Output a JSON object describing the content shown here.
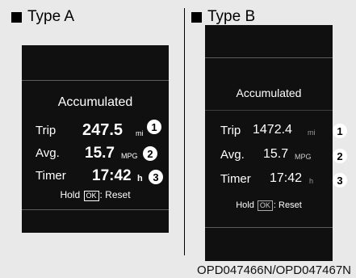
{
  "type_a": {
    "heading": "Type A",
    "accumulated": "Accumulated",
    "trip": {
      "label": "Trip",
      "value": "247.5",
      "unit": "mi",
      "callout": "1"
    },
    "avg": {
      "label": "Avg.",
      "value": "15.7",
      "unit": "MPG",
      "callout": "2"
    },
    "timer": {
      "label": "Timer",
      "value": "17:42",
      "unit": "h",
      "callout": "3"
    },
    "hold": {
      "prefix": "Hold",
      "ok": "OK",
      "suffix": ": Reset"
    }
  },
  "type_b": {
    "heading": "Type B",
    "accumulated": "Accumulated",
    "trip": {
      "label": "Trip",
      "value": "1472.4",
      "unit": "mi",
      "callout": "1"
    },
    "avg": {
      "label": "Avg.",
      "value": "15.7",
      "unit": "MPG",
      "callout": "2"
    },
    "timer": {
      "label": "Timer",
      "value": "17:42",
      "unit": "h",
      "callout": "3"
    },
    "hold": {
      "prefix": "Hold",
      "ok": "OK",
      "suffix": ": Reset"
    }
  },
  "caption": "OPD047466N/OPD047467N",
  "colors": {
    "background": "#e9e9e9",
    "screen": "#101010",
    "text": "#ffffff"
  }
}
